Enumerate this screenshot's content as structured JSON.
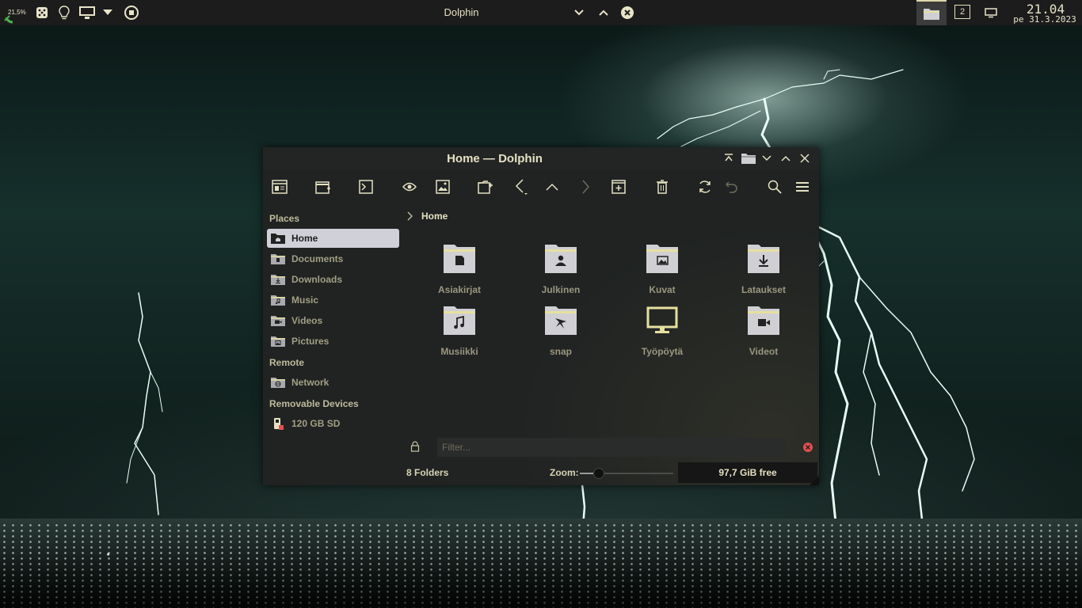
{
  "panel": {
    "battery_text": "21,5%",
    "active_window_title": "Dolphin",
    "virtual_desktop_number": "2",
    "clock_time": "21.04",
    "clock_date": "pe 31.3.2023",
    "icons": [
      "battery-icon",
      "dice-icon",
      "lightbulb-icon",
      "display-icon",
      "dropdown-arrow-icon",
      "media-stop-icon",
      "window-menu-icon",
      "window-maximize-icon",
      "window-close-icon",
      "file-manager-task-icon",
      "screen-icon"
    ]
  },
  "window": {
    "title": "Home — Dolphin",
    "toolbar": [
      "split-view-icon",
      "new-window-icon",
      "terminal-icon",
      "preview-eye-icon",
      "image-icon",
      "new-tab-icon",
      "back-icon",
      "up-icon",
      "forward-icon",
      "new-folder-icon",
      "trash-icon",
      "reload-icon",
      "undo-icon",
      "search-icon",
      "hamburger-menu-icon"
    ]
  },
  "sidebar": {
    "places_header": "Places",
    "places": [
      {
        "label": "Home",
        "selected": true
      },
      {
        "label": "Documents"
      },
      {
        "label": "Downloads"
      },
      {
        "label": "Music"
      },
      {
        "label": "Videos"
      },
      {
        "label": "Pictures"
      }
    ],
    "remote_header": "Remote",
    "remote": [
      {
        "label": "Network"
      }
    ],
    "removable_header": "Removable Devices",
    "removable": [
      {
        "label": "120 GB SD"
      }
    ]
  },
  "breadcrumb": {
    "current": "Home"
  },
  "files": [
    {
      "name": "Asiakirjat",
      "icon": "documents-folder-icon"
    },
    {
      "name": "Julkinen",
      "icon": "public-folder-icon"
    },
    {
      "name": "Kuvat",
      "icon": "pictures-folder-icon"
    },
    {
      "name": "Lataukset",
      "icon": "downloads-folder-icon"
    },
    {
      "name": "Musiikki",
      "icon": "music-folder-icon"
    },
    {
      "name": "snap",
      "icon": "snap-folder-icon"
    },
    {
      "name": "Työpöytä",
      "icon": "desktop-monitor-icon"
    },
    {
      "name": "Videot",
      "icon": "videos-folder-icon"
    }
  ],
  "filter": {
    "placeholder": "Filter..."
  },
  "status": {
    "folder_count": "8 Folders",
    "zoom_label": "Zoom:",
    "zoom_level": 0.2,
    "free_space": "97,7 GiB free"
  },
  "colors": {
    "accent": "#e6e1c3",
    "selected_bg": "#d0d0d8",
    "folder_body": "#cfcfd4",
    "folder_tab": "#e6e0a0",
    "close_red": "#e05050"
  }
}
